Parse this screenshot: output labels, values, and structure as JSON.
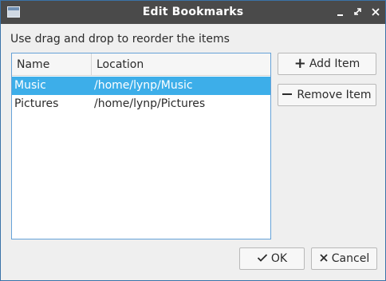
{
  "window": {
    "title": "Edit Bookmarks",
    "icons": {
      "app": "window-icon",
      "minimize": "minimize-icon",
      "maximize": "restore-icon",
      "close": "close-icon"
    }
  },
  "instruction": "Use drag and drop to reorder the items",
  "list": {
    "columns": [
      "Name",
      "Location"
    ],
    "rows": [
      {
        "name": "Music",
        "location": "/home/lynp/Music",
        "selected": true
      },
      {
        "name": "Pictures",
        "location": "/home/lynp/Pictures",
        "selected": false
      }
    ]
  },
  "buttons": {
    "add": "Add Item",
    "remove": "Remove Item",
    "ok": "OK",
    "cancel": "Cancel"
  },
  "colors": {
    "selection": "#3daee9",
    "titlebar": "#4a4a4a",
    "accent_border": "#66a2d8"
  }
}
